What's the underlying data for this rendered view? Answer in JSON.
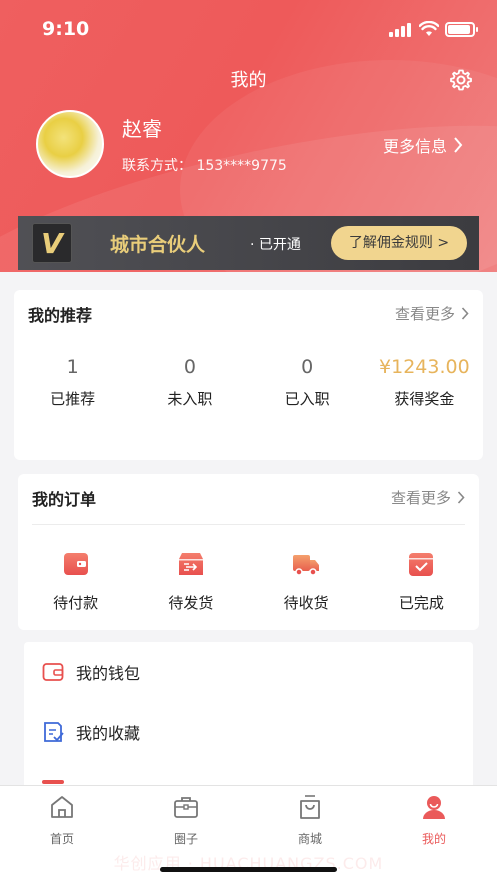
{
  "status_bar": {
    "time": "9:10"
  },
  "nav": {
    "title": "我的"
  },
  "profile": {
    "name": "赵睿",
    "contact": "联系方式：  153****9775",
    "more_info": "更多信息"
  },
  "partner": {
    "logo_letter": "V",
    "title": "城市合伙人",
    "status": "· 已开通",
    "button": "了解佣金规则 >"
  },
  "recommend": {
    "title": "我的推荐",
    "see_more": "查看更多",
    "stats": [
      {
        "value": "1",
        "label": "已推荐"
      },
      {
        "value": "0",
        "label": "未入职"
      },
      {
        "value": "0",
        "label": "已入职"
      },
      {
        "value": "¥1243.00",
        "label": "获得奖金"
      }
    ]
  },
  "orders": {
    "title": "我的订单",
    "see_more": "查看更多",
    "items": [
      {
        "icon": "wallet-card-icon",
        "label": "待付款"
      },
      {
        "icon": "shipping-box-icon",
        "label": "待发货"
      },
      {
        "icon": "delivery-truck-icon",
        "label": "待收货"
      },
      {
        "icon": "completed-check-icon",
        "label": "已完成"
      }
    ]
  },
  "menu": [
    {
      "icon": "wallet-icon",
      "label": "我的钱包"
    },
    {
      "icon": "favorites-icon",
      "label": "我的收藏"
    }
  ],
  "tabbar": [
    {
      "icon": "home-icon",
      "label": "首页"
    },
    {
      "icon": "circle-briefcase-icon",
      "label": "圈子"
    },
    {
      "icon": "shopping-bag-icon",
      "label": "商城"
    },
    {
      "icon": "profile-icon",
      "label": "我的",
      "active": true
    }
  ],
  "watermark": "华创应用 · HUACHUANGZS.COM",
  "colors": {
    "primary": "#ea5a5a",
    "gold": "#e7b45c",
    "partner_gold": "#e9cd7a"
  }
}
